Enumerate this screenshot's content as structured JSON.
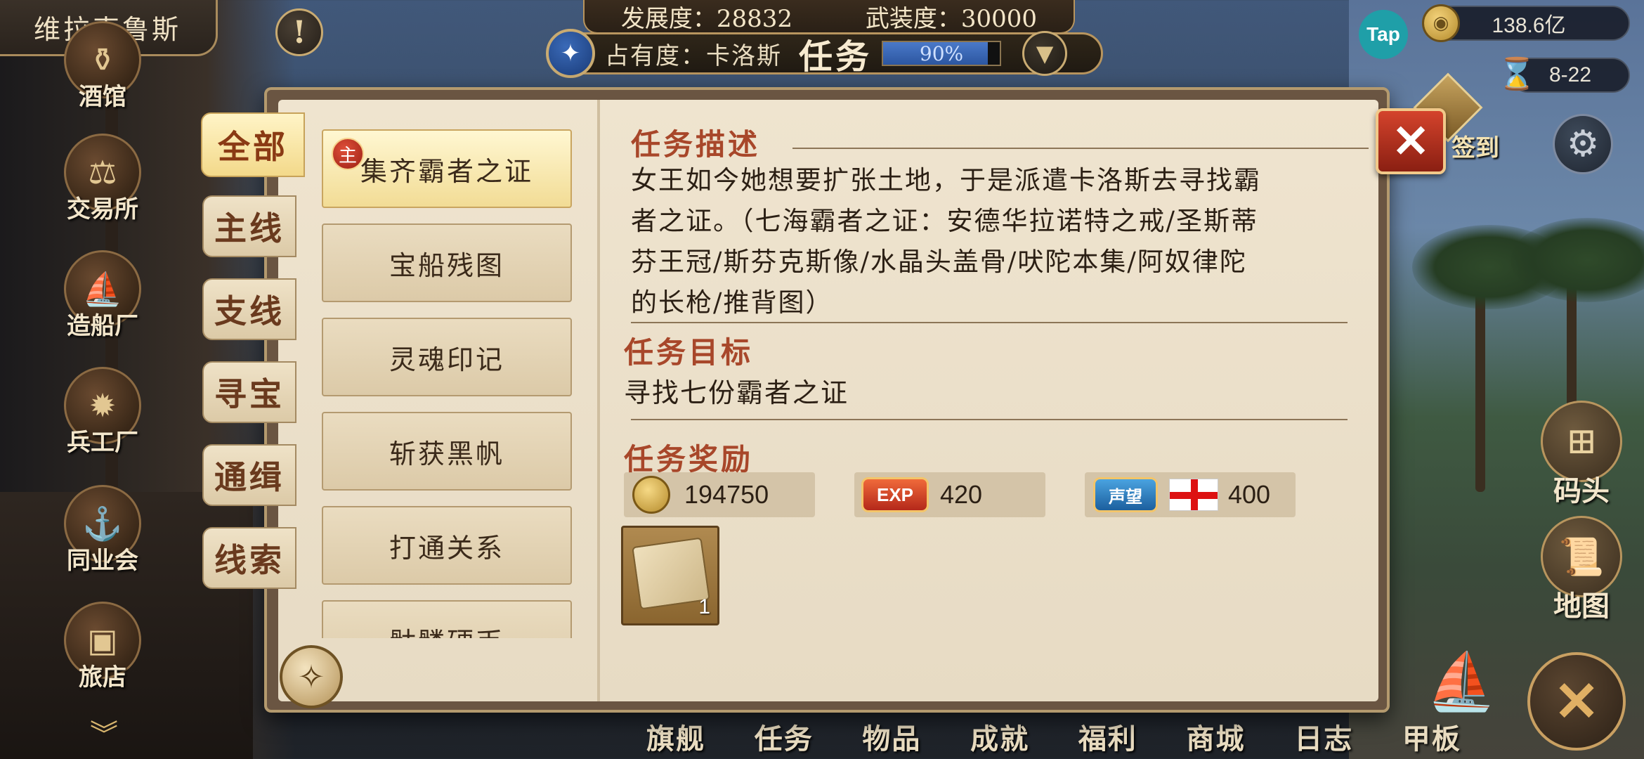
{
  "city_name": "维拉克鲁斯",
  "stats": {
    "development_label": "发展度：28832",
    "armament_label": "武装度：30000",
    "occupancy_label": "占有度：卡洛斯",
    "panel_title": "任务",
    "occupancy_progress_text": "90%",
    "occupancy_progress": 0.9
  },
  "top_right": {
    "tap_label": "Tap",
    "gold_amount": "138.6亿",
    "date": "8-22",
    "signin_label": "签到"
  },
  "side_menu": [
    "酒馆",
    "交易所",
    "造船厂",
    "兵工厂",
    "同业会",
    "旅店"
  ],
  "side_menu_icons": [
    "tavern-icon",
    "scales-icon",
    "shipyard-icon",
    "cannon-icon",
    "anchor-shield-icon",
    "chest-icon"
  ],
  "right_buttons": [
    "码头",
    "地图"
  ],
  "bottom_nav": [
    "旗舰",
    "任务",
    "物品",
    "成就",
    "福利",
    "商城",
    "日志",
    "甲板"
  ],
  "categories": [
    "全部",
    "主线",
    "支线",
    "寻宝",
    "通缉",
    "线索"
  ],
  "quests": [
    {
      "title": "集齐霸者之证",
      "badge": "主"
    },
    {
      "title": "宝船残图"
    },
    {
      "title": "灵魂印记"
    },
    {
      "title": "斩获黑帆"
    },
    {
      "title": "打通关系"
    },
    {
      "title": "骷髅硬币"
    }
  ],
  "detail": {
    "description_title": "任务描述",
    "description_lines": [
      "女王如今她想要扩张土地，于是派遣卡洛斯去寻找霸",
      "者之证。（七海霸者之证：安德华拉诺特之戒/圣斯蒂",
      "芬王冠/斯芬克斯像/水晶头盖骨/吠陀本集/阿奴律陀",
      "的长枪/推背图）"
    ],
    "goal_title": "任务目标",
    "goal_text": "寻找七份霸者之证",
    "reward_title": "任务奖励",
    "rewards": {
      "gold": "194750",
      "exp_badge": "EXP",
      "exp": "420",
      "fame_badge": "声望",
      "fame": "400"
    },
    "item_count": "1"
  },
  "colors": {
    "accent_red": "#a8472a",
    "gold": "#c9ab72",
    "paper": "#efe4cf"
  }
}
